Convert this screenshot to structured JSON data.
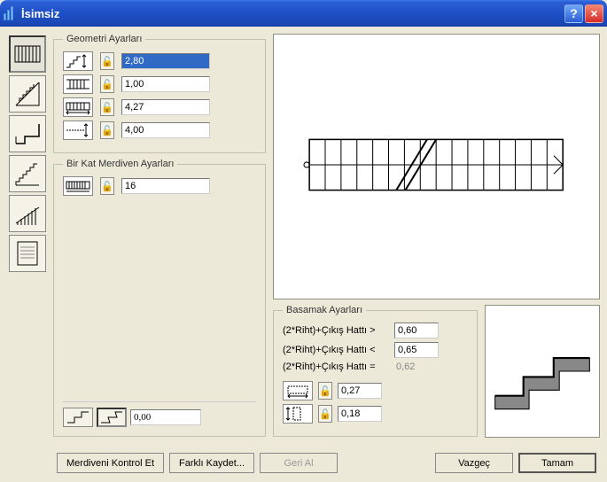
{
  "title": "İsimsiz",
  "geometry": {
    "legend": "Geometri Ayarları",
    "rows": [
      {
        "value": "2,80",
        "selected": true
      },
      {
        "value": "1,00"
      },
      {
        "value": "4,27"
      },
      {
        "value": "4,00"
      }
    ]
  },
  "flight": {
    "legend": "Bir Kat Merdiven Ayarları",
    "count": "16",
    "offset": "0,00"
  },
  "basamak": {
    "legend": "Basamak Ayarları",
    "label_gt": "(2*Riht)+Çıkış Hattı >",
    "label_lt": "(2*Riht)+Çıkış Hattı <",
    "label_eq": "(2*Riht)+Çıkış Hattı =",
    "gt": "0,60",
    "lt": "0,65",
    "eq": "0,62",
    "tread": "0,27",
    "riser": "0,18"
  },
  "buttons": {
    "check": "Merdiveni Kontrol Et",
    "saveas": "Farklı Kaydet...",
    "undo": "Geri Al",
    "cancel": "Vazgeç",
    "ok": "Tamam"
  },
  "chart_data": {
    "type": "diagram",
    "title": "Straight-run stair plan",
    "steps": 16,
    "run_length_m": 4.27,
    "width_m": 1.0
  }
}
